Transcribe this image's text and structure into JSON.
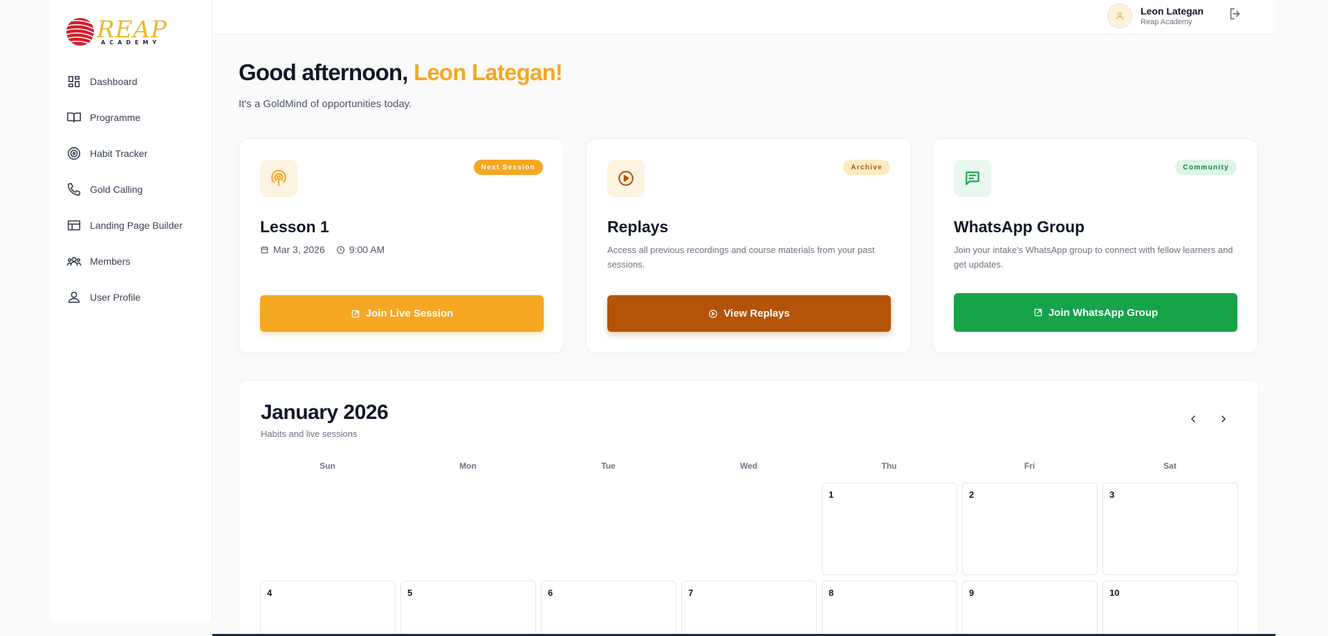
{
  "brand": {
    "logo_text": "REAP",
    "logo_sub": "ACADEMY"
  },
  "sidebar": {
    "items": [
      {
        "label": "Dashboard",
        "icon": "dashboard-icon"
      },
      {
        "label": "Programme",
        "icon": "book-icon"
      },
      {
        "label": "Habit Tracker",
        "icon": "target-icon"
      },
      {
        "label": "Gold Calling",
        "icon": "phone-icon"
      },
      {
        "label": "Landing Page Builder",
        "icon": "layout-icon"
      },
      {
        "label": "Members",
        "icon": "members-icon"
      },
      {
        "label": "User Profile",
        "icon": "user-icon"
      }
    ]
  },
  "header": {
    "user_name": "Leon Lategan",
    "user_org": "Reap Academy"
  },
  "greeting": {
    "prefix": "Good afternoon, ",
    "name": "Leon Lategan!",
    "subtitle": "It's a GoldMind of opportunities today."
  },
  "cards": {
    "lesson": {
      "badge": "Next Session",
      "title": "Lesson 1",
      "date": "Mar 3, 2026",
      "time": "9:00 AM",
      "button": "Join Live Session"
    },
    "replays": {
      "badge": "Archive",
      "title": "Replays",
      "description": "Access all previous recordings and course materials from your past sessions.",
      "button": "View Replays"
    },
    "whatsapp": {
      "badge": "Community",
      "title": "WhatsApp Group",
      "description": "Join your intake's WhatsApp group to connect with fellow learners and get updates.",
      "button": "Join WhatsApp Group"
    }
  },
  "calendar": {
    "title": "January 2026",
    "subtitle": "Habits and live sessions",
    "weekdays": [
      "Sun",
      "Mon",
      "Tue",
      "Wed",
      "Thu",
      "Fri",
      "Sat"
    ],
    "first_weekday": 4,
    "visible_days": [
      1,
      2,
      3,
      4,
      5,
      6,
      7,
      8,
      9,
      10
    ]
  },
  "colors": {
    "accent": "#f5a623",
    "replays_button": "#b4530a",
    "whatsapp_button": "#16a34a"
  }
}
